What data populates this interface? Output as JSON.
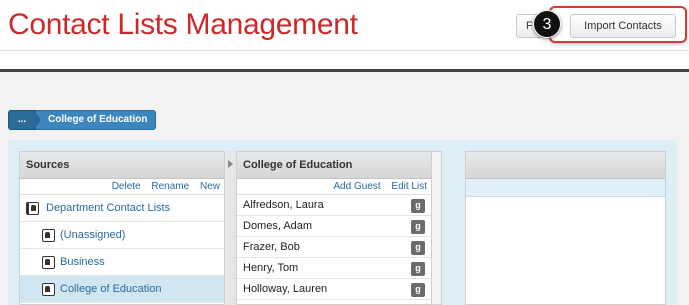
{
  "header": {
    "title": "Contact Lists Management",
    "partial_button_label": "F",
    "import_button_label": "Import Contacts",
    "step_number": "3"
  },
  "breadcrumb": {
    "more_label": "...",
    "current_label": "College of Education"
  },
  "sources": {
    "header": "Sources",
    "actions": [
      "Delete",
      "Rename",
      "New"
    ],
    "items": [
      {
        "label": "Department Contact Lists"
      },
      {
        "label": "(Unassigned)"
      },
      {
        "label": "Business"
      },
      {
        "label": "College of Education"
      }
    ]
  },
  "contacts": {
    "header": "College of Education",
    "actions": [
      "Add Guest",
      "Edit List"
    ],
    "row_button_label": "g",
    "rows": [
      {
        "name": "Alfredson, Laura"
      },
      {
        "name": "Domes, Adam"
      },
      {
        "name": "Frazer, Bob"
      },
      {
        "name": "Henry, Tom"
      },
      {
        "name": "Holloway, Lauren"
      }
    ]
  },
  "colors": {
    "title_red": "#cc2a2a",
    "highlight_red": "#d63b3b",
    "link_blue": "#2a6b9c",
    "breadcrumb_blue": "#3d86bd",
    "selected_bg": "#d0e6f3",
    "panel_bg": "#ddeef6"
  }
}
